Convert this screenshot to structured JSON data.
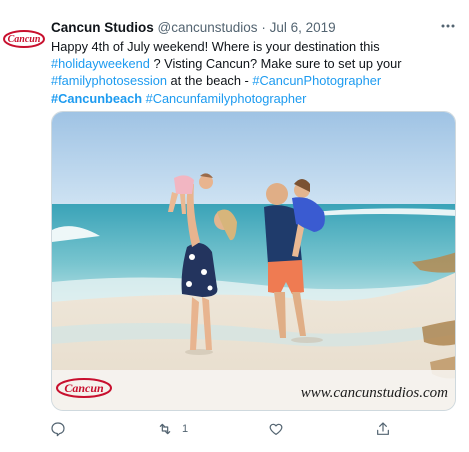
{
  "tweet": {
    "author_name": "Cancun Studios",
    "handle": "@cancunstudios",
    "separator": "·",
    "date": "Jul 6, 2019",
    "avatar_logo_text": "Cancun Studios",
    "text": {
      "line1": "Happy 4th of July weekend!  Where is your destination this",
      "hashtag_holiday": "#holidayweekend",
      "line2_rest": " ? Visting Cancun?  Make sure to set up your",
      "hashtag_family": "#familyphotosession",
      "line3_mid": " at the beach - ",
      "hashtag_photographer": "#CancunPhotographer",
      "hashtag_beach": "#Cancunbeach",
      "hashtag_familyphotographer": " #Cancunfamilyphotographer"
    },
    "media": {
      "watermark_url": "www.cancunstudios.com",
      "watermark_logo": "Cancun studios"
    },
    "actions": {
      "retweet_count": "1"
    }
  },
  "colors": {
    "link": "#1d9bf0",
    "muted": "#536471",
    "brand_red": "#c8102e"
  },
  "icons": [
    "more-icon",
    "reply-icon",
    "retweet-icon",
    "like-icon",
    "share-icon"
  ]
}
